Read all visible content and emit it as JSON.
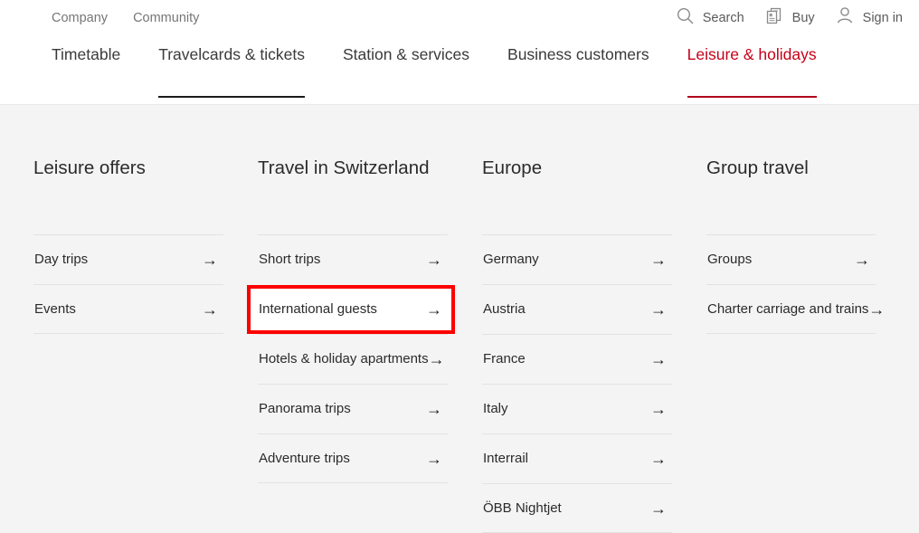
{
  "header": {
    "meta_links": [
      {
        "label": "Company",
        "name": "meta-link-company"
      },
      {
        "label": "Community",
        "name": "meta-link-community"
      }
    ],
    "utility": [
      {
        "label": "Search",
        "icon": "search-icon"
      },
      {
        "label": "Buy",
        "icon": "ticket-icon"
      },
      {
        "label": "Sign in",
        "icon": "user-icon"
      }
    ],
    "nav": [
      {
        "label": "Timetable",
        "state": "default"
      },
      {
        "label": "Travelcards & tickets",
        "state": "hover"
      },
      {
        "label": "Station & services",
        "state": "default"
      },
      {
        "label": "Business customers",
        "state": "default"
      },
      {
        "label": "Leisure & holidays",
        "state": "active"
      }
    ]
  },
  "flyout": {
    "columns": [
      {
        "title": "Leisure offers",
        "items": [
          {
            "label": "Day trips",
            "arrow": "→",
            "highlighted": false
          },
          {
            "label": "Events",
            "arrow": "→",
            "highlighted": false
          }
        ]
      },
      {
        "title": "Travel in Switzerland",
        "items": [
          {
            "label": "Short trips",
            "arrow": "→",
            "highlighted": false
          },
          {
            "label": "International guests",
            "arrow": "→",
            "highlighted": true
          },
          {
            "label": "Hotels & holiday apartments",
            "arrow": "→",
            "highlighted": false
          },
          {
            "label": "Panorama trips",
            "arrow": "→",
            "highlighted": false
          },
          {
            "label": "Adventure trips",
            "arrow": "→",
            "highlighted": false
          }
        ]
      },
      {
        "title": "Europe",
        "items": [
          {
            "label": "Germany",
            "arrow": "→",
            "highlighted": false
          },
          {
            "label": "Austria",
            "arrow": "→",
            "highlighted": false
          },
          {
            "label": "France",
            "arrow": "→",
            "highlighted": false
          },
          {
            "label": "Italy",
            "arrow": "→",
            "highlighted": false
          },
          {
            "label": "Interrail",
            "arrow": "→",
            "highlighted": false
          },
          {
            "label": "ÖBB Nightjet",
            "arrow": "→",
            "highlighted": false
          }
        ]
      },
      {
        "title": "Group travel",
        "items": [
          {
            "label": "Groups",
            "arrow": "→",
            "highlighted": false
          },
          {
            "label": "Charter carriage and trains",
            "arrow": "→",
            "highlighted": false
          }
        ]
      }
    ]
  },
  "colors": {
    "brand_red": "#c60018",
    "active_underline": "#b0001c",
    "hover_underline": "#1a1a1a",
    "annotation_red": "#fc0000",
    "panel_bg": "#f4f4f4",
    "divider": "#e2e2e2"
  }
}
